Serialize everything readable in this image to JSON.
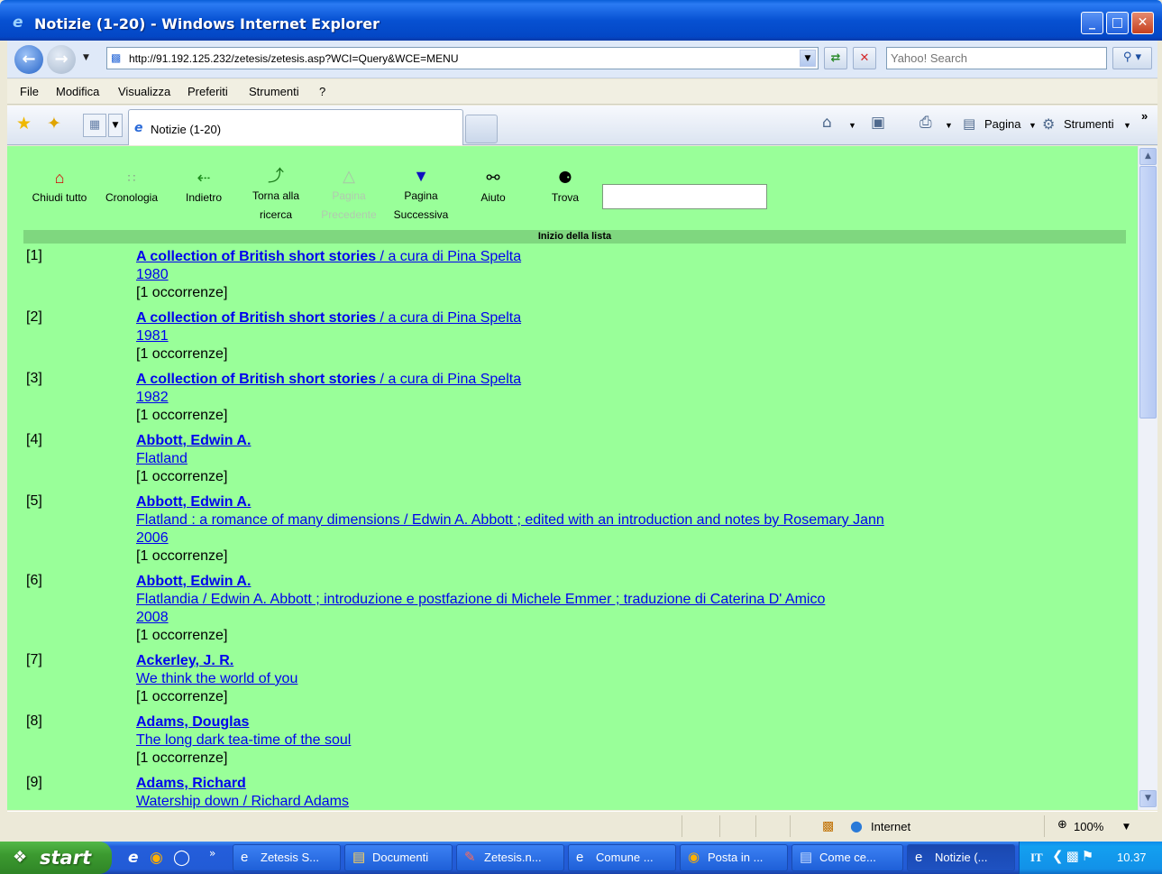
{
  "window": {
    "title": "Notizie (1-20) - Windows Internet Explorer",
    "minimize_glyph": "_",
    "maximize_glyph": "□",
    "close_glyph": "✕"
  },
  "addressbar": {
    "url": "http://91.192.125.232/zetesis/zetesis.asp?WCI=Query&WCE=MENU",
    "search_placeholder": "Yahoo! Search"
  },
  "menu": [
    "File",
    "Modifica",
    "Visualizza",
    "Preferiti",
    "Strumenti",
    "?"
  ],
  "tabbar": {
    "active_tab": "Notizie (1-20)",
    "commands": {
      "page": "Pagina",
      "tools": "Strumenti"
    }
  },
  "page_toolbar": [
    {
      "label_1": "",
      "label_2": "Chiudi tutto",
      "icon": "home-icon",
      "enabled": true
    },
    {
      "label_1": "",
      "label_2": "Cronologia",
      "icon": "history-icon",
      "enabled": true
    },
    {
      "label_1": "",
      "label_2": "Indietro",
      "icon": "back-arrow-icon",
      "enabled": true
    },
    {
      "label_1": "Torna alla",
      "label_2": "ricerca",
      "icon": "return-search-icon",
      "enabled": true
    },
    {
      "label_1": "Pagina",
      "label_2": "Precedente",
      "icon": "up-triangle-icon",
      "enabled": false
    },
    {
      "label_1": "Pagina",
      "label_2": "Successiva",
      "icon": "down-triangle-icon",
      "enabled": true
    },
    {
      "label_1": "",
      "label_2": "Aiuto",
      "icon": "lifebuoy-icon",
      "enabled": true
    },
    {
      "label_1": "",
      "label_2": "Trova",
      "icon": "binoculars-icon",
      "enabled": true
    }
  ],
  "list_header": "Inizio della lista",
  "records": [
    {
      "num": "[1]",
      "heading": "A collection of British short stories",
      "heading_rest": " / a cura di Pina Spelta",
      "detail": "",
      "year": "1980",
      "occ": "[1 occorrenze]"
    },
    {
      "num": "[2]",
      "heading": "A collection of British short stories",
      "heading_rest": " / a cura di Pina Spelta",
      "detail": "",
      "year": "1981",
      "occ": "[1 occorrenze]"
    },
    {
      "num": "[3]",
      "heading": "A collection of British short stories",
      "heading_rest": " / a cura di Pina Spelta",
      "detail": "",
      "year": "1982",
      "occ": "[1 occorrenze]"
    },
    {
      "num": "[4]",
      "heading": "Abbott, Edwin A.",
      "heading_rest": "",
      "detail": "",
      "year": "Flatland",
      "occ": "[1 occorrenze]"
    },
    {
      "num": "[5]",
      "heading": "Abbott, Edwin A.",
      "heading_rest": "",
      "detail": "Flatland : a romance of many dimensions / Edwin A. Abbott ; edited with an introduction and notes by Rosemary Jann",
      "year": "2006",
      "occ": "[1 occorrenze]"
    },
    {
      "num": "[6]",
      "heading": "Abbott, Edwin A.",
      "heading_rest": "",
      "detail": "Flatlandia / Edwin A. Abbott ; introduzione e postfazione di Michele Emmer ; traduzione di Caterina D' Amico",
      "year": "2008",
      "occ": "[1 occorrenze]"
    },
    {
      "num": "[7]",
      "heading": "Ackerley, J. R.",
      "heading_rest": "",
      "detail": "",
      "year": "We think the world of you",
      "occ": "[1 occorrenze]"
    },
    {
      "num": "[8]",
      "heading": "Adams, Douglas",
      "heading_rest": "",
      "detail": "",
      "year": "The long dark tea-time of the soul",
      "occ": "[1 occorrenze]"
    },
    {
      "num": "[9]",
      "heading": "Adams, Richard",
      "heading_rest": "",
      "detail": "",
      "year": "Watership down / Richard Adams",
      "occ": ""
    }
  ],
  "statusbar": {
    "zone": "Internet",
    "zoom": "100%"
  },
  "taskbar": {
    "start": "start",
    "tasks": [
      {
        "label": "Zetesis S...",
        "icon": "ie-icon"
      },
      {
        "label": "Documenti",
        "icon": "folder-icon"
      },
      {
        "label": "Zetesis.n...",
        "icon": "document-icon"
      },
      {
        "label": "Comune ...",
        "icon": "ie-icon"
      },
      {
        "label": "Posta in ...",
        "icon": "outlook-icon"
      },
      {
        "label": "Come ce...",
        "icon": "word-icon"
      },
      {
        "label": "Notizie (...",
        "icon": "ie-icon"
      }
    ],
    "language": "IT",
    "clock": "10.37"
  }
}
